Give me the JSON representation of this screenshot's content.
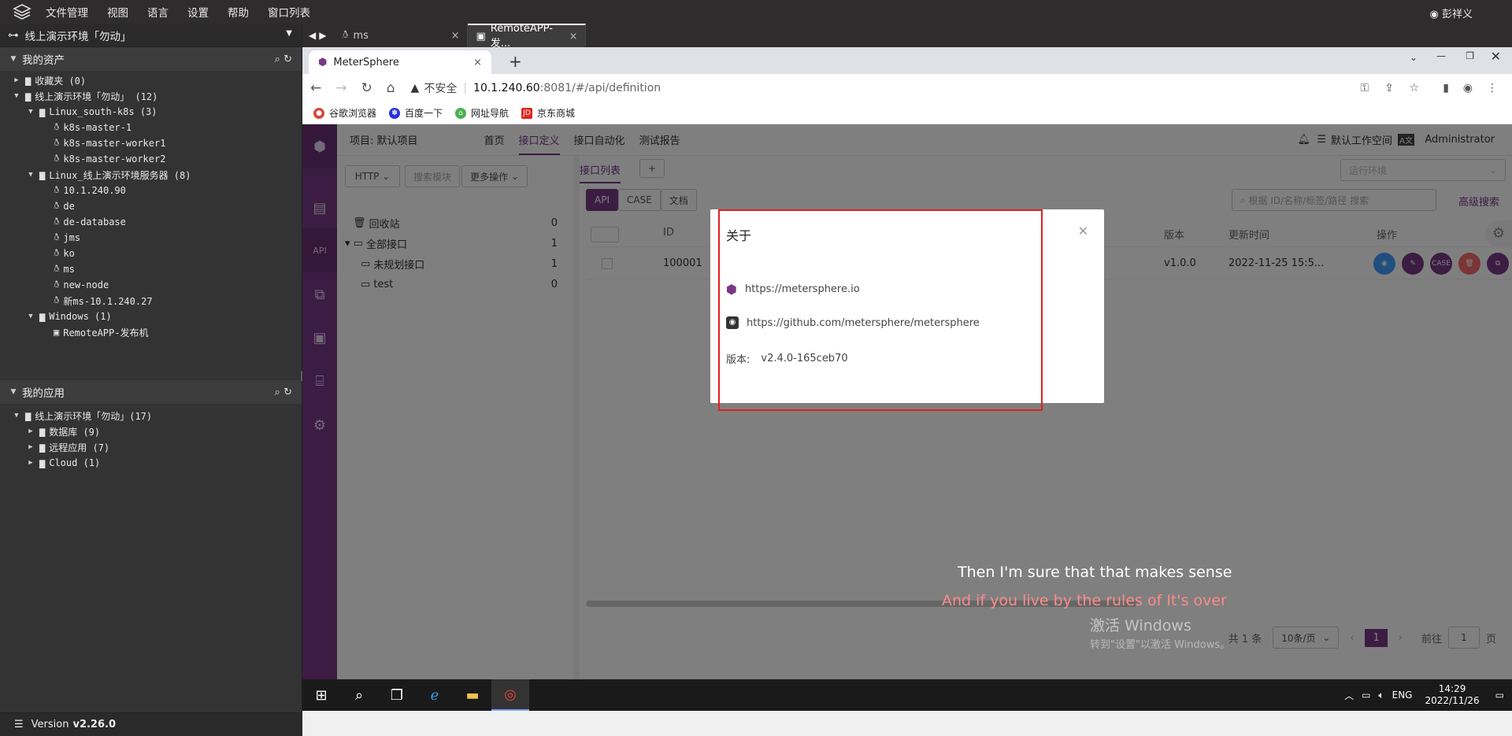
{
  "menubar": {
    "items": [
      "文件管理",
      "视图",
      "语言",
      "设置",
      "帮助",
      "窗口列表"
    ],
    "user": "彭祥义"
  },
  "left": {
    "env": "线上演示环境「勿动」",
    "assets_title": "我的资产",
    "assets": [
      {
        "text": "收藏夹 (0)",
        "level": 0,
        "caret": "▶",
        "icon": "folder"
      },
      {
        "text": "线上演示环境「勿动」 (12)",
        "level": 0,
        "caret": "▼",
        "icon": "folder-open"
      },
      {
        "text": "Linux_south-k8s (3)",
        "level": 1,
        "caret": "▼",
        "icon": "folder-open"
      },
      {
        "text": "k8s-master-1",
        "level": 2,
        "caret": "",
        "icon": "linux"
      },
      {
        "text": "k8s-master-worker1",
        "level": 2,
        "caret": "",
        "icon": "linux"
      },
      {
        "text": "k8s-master-worker2",
        "level": 2,
        "caret": "",
        "icon": "linux"
      },
      {
        "text": "Linux_线上演示环境服务器 (8)",
        "level": 1,
        "caret": "▼",
        "icon": "folder-open"
      },
      {
        "text": "10.1.240.90",
        "level": 2,
        "caret": "",
        "icon": "linux"
      },
      {
        "text": "de",
        "level": 2,
        "caret": "",
        "icon": "linux"
      },
      {
        "text": "de-database",
        "level": 2,
        "caret": "",
        "icon": "linux"
      },
      {
        "text": "jms",
        "level": 2,
        "caret": "",
        "icon": "linux"
      },
      {
        "text": "ko",
        "level": 2,
        "caret": "",
        "icon": "linux"
      },
      {
        "text": "ms",
        "level": 2,
        "caret": "",
        "icon": "linux"
      },
      {
        "text": "new-node",
        "level": 2,
        "caret": "",
        "icon": "linux"
      },
      {
        "text": "新ms-10.1.240.27",
        "level": 2,
        "caret": "",
        "icon": "linux"
      },
      {
        "text": "Windows (1)",
        "level": 1,
        "caret": "▼",
        "icon": "folder-open"
      },
      {
        "text": "RemoteAPP-发布机",
        "level": 2,
        "caret": "",
        "icon": "windows"
      }
    ],
    "apps_title": "我的应用",
    "apps": [
      {
        "text": "线上演示环境「勿动」(17)",
        "level": 0,
        "caret": "▼",
        "icon": "folder-open"
      },
      {
        "text": "数据库 (9)",
        "level": 1,
        "caret": "▶",
        "icon": "folder"
      },
      {
        "text": "远程应用 (7)",
        "level": 1,
        "caret": "▶",
        "icon": "folder"
      },
      {
        "text": "Cloud (1)",
        "level": 1,
        "caret": "▶",
        "icon": "folder"
      }
    ],
    "version_label": "Version",
    "version_value": "v2.26.0"
  },
  "session_tabs": [
    {
      "label": "ms",
      "active": false
    },
    {
      "label": "RemoteAPP-发...",
      "active": true
    }
  ],
  "browser": {
    "tab_title": "MeterSphere",
    "insecure": "不安全",
    "url_host": "10.1.240.60",
    "url_rest": ":8081/#/api/definition",
    "bookmarks": [
      "谷歌浏览器",
      "百度一下",
      "网址导航",
      "京东商城"
    ]
  },
  "app": {
    "project": "项目: 默认项目",
    "nav": [
      "首页",
      "接口定义",
      "接口自动化",
      "测试报告"
    ],
    "workspace": "默认工作空间",
    "admin": "Administrator",
    "protocol": "HTTP",
    "search_module": "搜索模块",
    "more_ops": "更多操作",
    "tree": [
      {
        "text": "回收站",
        "count": "0"
      },
      {
        "text": "全部接口",
        "count": "1"
      },
      {
        "text": "未规划接口",
        "count": "1"
      },
      {
        "text": "test",
        "count": "0"
      }
    ],
    "list_tab": "接口列表",
    "env_placeholder": "运行环境",
    "mode_buttons": [
      "API",
      "CASE",
      "文档"
    ],
    "search_placeholder": "根据 ID/名称/标签/路径 搜索",
    "advanced": "高级搜索",
    "cols": [
      "ID",
      "版本",
      "更新时间",
      "操作"
    ],
    "row": {
      "id": "100001",
      "version": "v1.0.0",
      "updated": "2022-11-25 15:5..."
    },
    "total": "共 1 条",
    "page_size": "10条/页",
    "page": "1",
    "goto": "前往",
    "goto_val": "1",
    "page_unit": "页"
  },
  "dialog": {
    "title": "关于",
    "link1": "https://metersphere.io",
    "link2": "https://github.com/metersphere/metersphere",
    "version_label": "版本:",
    "version_value": "v2.4.0-165ceb70"
  },
  "overlay_text": {
    "lyric1": "Then I'm sure that that makes sense",
    "lyric2": "And if you live by the rules of It's over",
    "activate1": "激活 Windows",
    "activate2": "转到\"设置\"以激活 Windows。"
  },
  "taskbar": {
    "lang": "ENG",
    "time": "14:29",
    "date": "2022/11/26"
  }
}
